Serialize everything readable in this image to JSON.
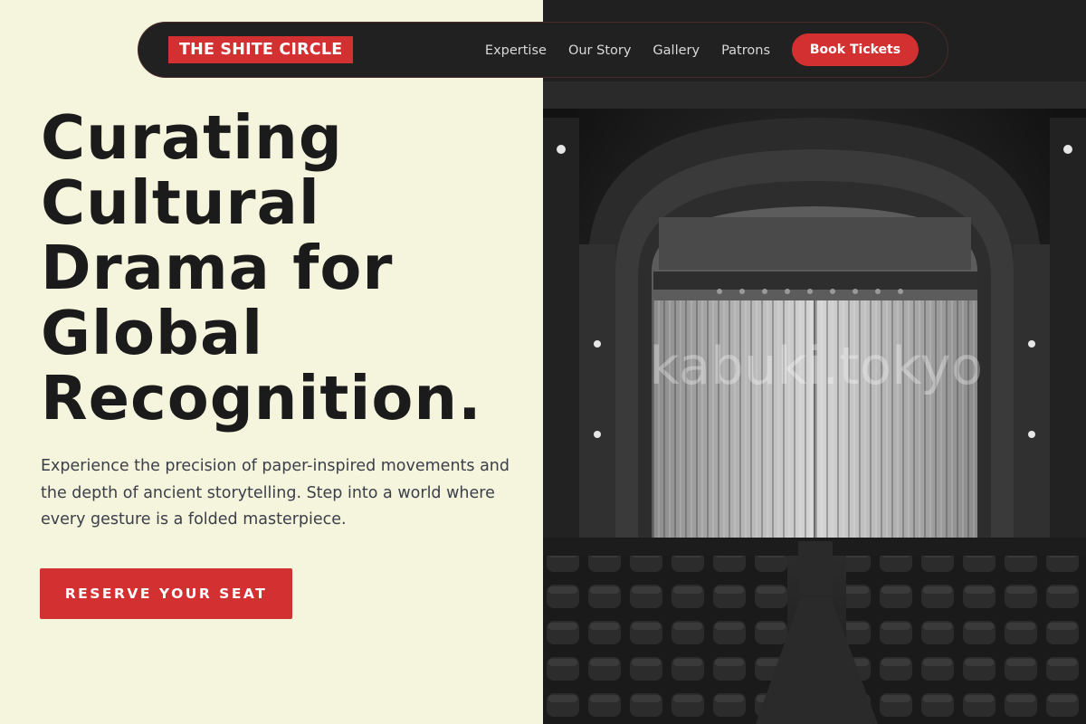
{
  "nav": {
    "logo": "THE SHITE CIRCLE",
    "links": [
      "Expertise",
      "Our Story",
      "Gallery",
      "Patrons"
    ],
    "cta": "Book Tickets"
  },
  "hero": {
    "title_lines": [
      "Curating",
      "Cultural",
      "Drama for",
      "Global",
      "Recognition."
    ],
    "description": "Experience the precision of paper-inspired movements and the depth of ancient storytelling. Step into a world where every gesture is a folded masterpiece.",
    "cta": "RESERVE YOUR SEAT"
  },
  "image": {
    "watermark": "kabuki.tokyo"
  },
  "colors": {
    "accent": "#d33131",
    "background": "#f5f4dc",
    "nav": "#222121",
    "heading": "#1b1b1b"
  }
}
